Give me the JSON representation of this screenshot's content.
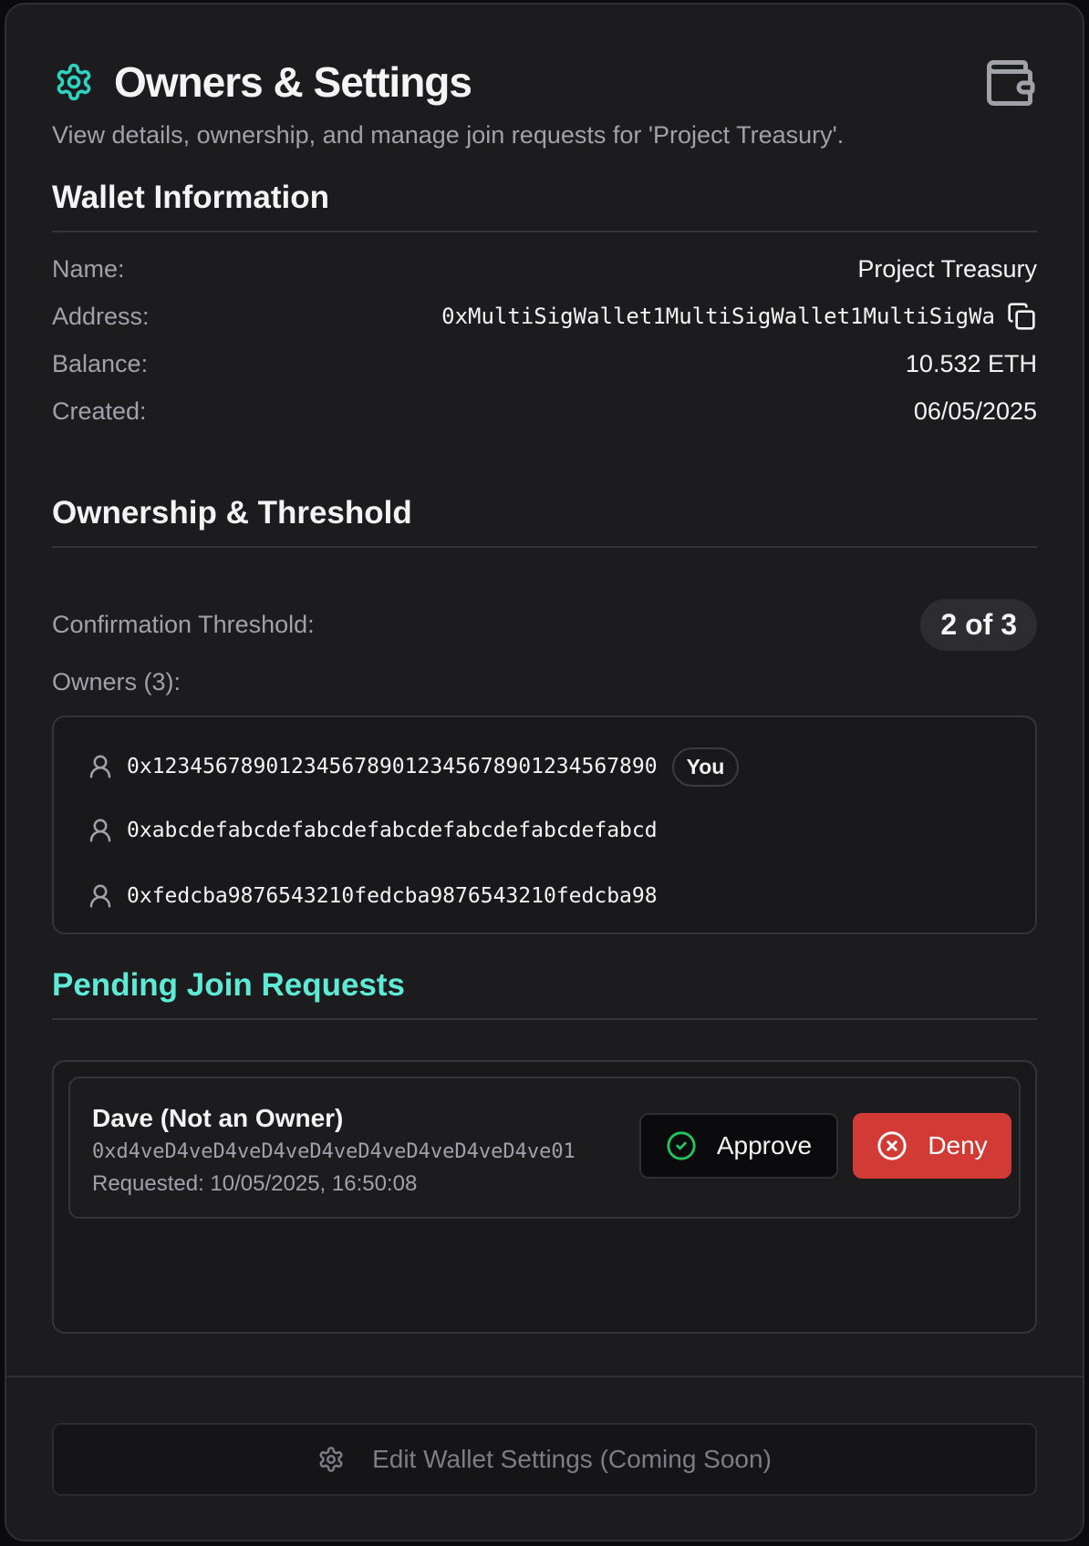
{
  "header": {
    "title": "Owners & Settings",
    "subtitle": "View details, ownership, and manage join requests for 'Project Treasury'.",
    "icons": {
      "title": "gear-icon",
      "wallet": "wallet-icon"
    }
  },
  "wallet_info": {
    "section_title": "Wallet Information",
    "rows": [
      {
        "label": "Name:",
        "value": "Project Treasury"
      },
      {
        "label": "Address:",
        "value": "0xMultiSigWallet1MultiSigWallet1MultiSigWa"
      },
      {
        "label": "Balance:",
        "value": "10.532 ETH"
      },
      {
        "label": "Created:",
        "value": "06/05/2025"
      }
    ]
  },
  "ownership": {
    "section_title": "Ownership & Threshold",
    "threshold_label": "Confirmation Threshold:",
    "threshold_value": "2 of 3",
    "owners_label": "Owners (3):",
    "owners": [
      {
        "address": "0x1234567890123456789012345678901234567890",
        "badge": "You"
      },
      {
        "address": "0xabcdefabcdefabcdefabcdefabcdefabcdefabcd"
      },
      {
        "address": "0xfedcba9876543210fedcba9876543210fedcba98"
      }
    ]
  },
  "pending_requests": {
    "section_title": "Pending Join Requests",
    "items": [
      {
        "name": "Dave (Not an Owner)",
        "address": "0xd4veD4veD4veD4veD4veD4veD4veD4veD4ve01",
        "requested": "Requested: 10/05/2025, 16:50:08",
        "approve_label": "Approve",
        "deny_label": "Deny"
      }
    ]
  },
  "footer": {
    "edit_label": "Edit Wallet Settings (Coming Soon)"
  },
  "colors": {
    "accent_teal": "#2dd4bf",
    "section_teal": "#5eead4",
    "deny_red": "#d23a35",
    "approve_green": "#22c55e",
    "background": "#1c1c1f"
  }
}
